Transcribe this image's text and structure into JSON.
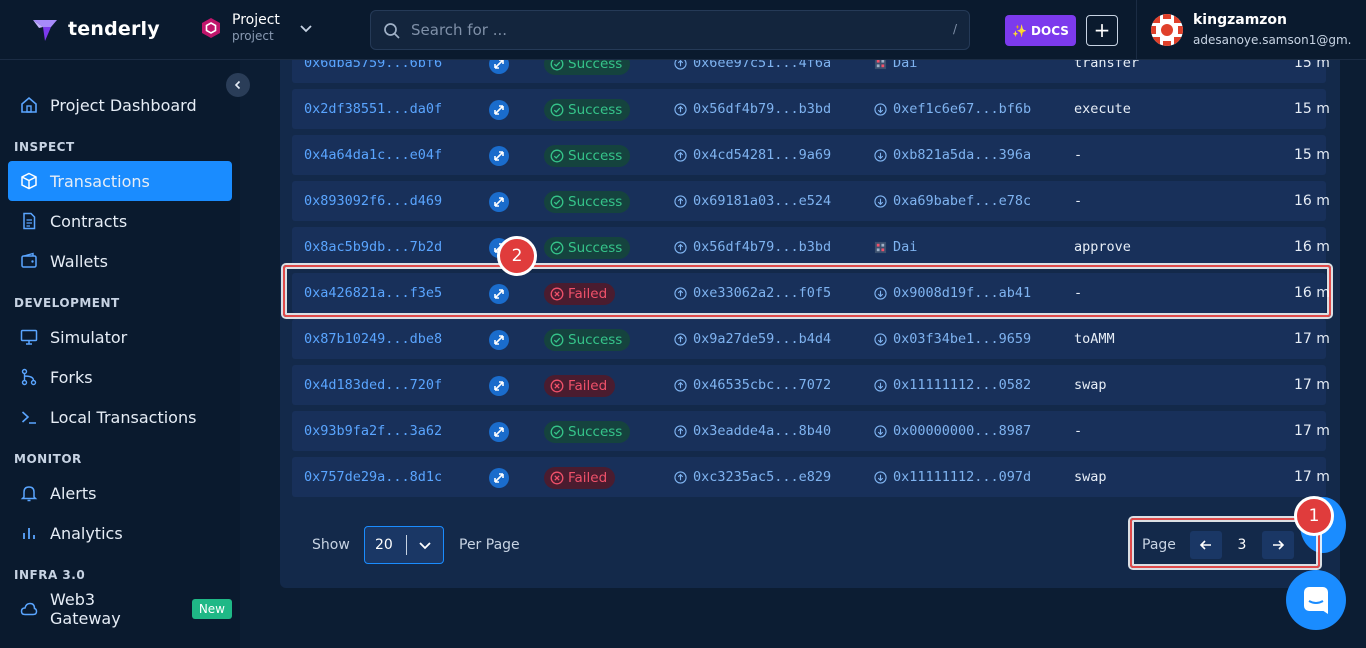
{
  "header": {
    "brand": "tenderly",
    "project_name": "Project",
    "project_sub": "project",
    "search_placeholder": "Search for ...",
    "search_shortcut": "/",
    "docs_label": "DOCS",
    "plus_label": "+",
    "user_name": "kingzamzon",
    "user_email": "adesanoye.samson1@gm..."
  },
  "sidebar": {
    "project_dashboard": "Project Dashboard",
    "sections": {
      "inspect": "INSPECT",
      "development": "DEVELOPMENT",
      "monitor": "MONITOR",
      "infra": "INFRA 3.0"
    },
    "items": {
      "transactions": "Transactions",
      "contracts": "Contracts",
      "wallets": "Wallets",
      "simulator": "Simulator",
      "forks": "Forks",
      "local_transactions": "Local Transactions",
      "alerts": "Alerts",
      "analytics": "Analytics",
      "web3_gateway": "Web3 Gateway"
    },
    "new_badge": "New"
  },
  "table": {
    "rows": [
      {
        "hash": "0x6dba5759...6bf6",
        "status": "Success",
        "from": "0x6ee97c51...4f6a",
        "to": "Dai",
        "to_is_token": true,
        "fn": "transfer",
        "time": "15 m"
      },
      {
        "hash": "0x2df38551...da0f",
        "status": "Success",
        "from": "0x56df4b79...b3bd",
        "to": "0xef1c6e67...bf6b",
        "to_is_token": false,
        "fn": "execute",
        "time": "15 m"
      },
      {
        "hash": "0x4a64da1c...e04f",
        "status": "Success",
        "from": "0x4cd54281...9a69",
        "to": "0xb821a5da...396a",
        "to_is_token": false,
        "fn": "-",
        "time": "15 m"
      },
      {
        "hash": "0x893092f6...d469",
        "status": "Success",
        "from": "0x69181a03...e524",
        "to": "0xa69babef...e78c",
        "to_is_token": false,
        "fn": "-",
        "time": "16 m"
      },
      {
        "hash": "0x8ac5b9db...7b2d",
        "status": "Success",
        "from": "0x56df4b79...b3bd",
        "to": "Dai",
        "to_is_token": true,
        "fn": "approve",
        "time": "16 m"
      },
      {
        "hash": "0xa426821a...f3e5",
        "status": "Failed",
        "from": "0xe33062a2...f0f5",
        "to": "0x9008d19f...ab41",
        "to_is_token": false,
        "fn": "-",
        "time": "16 m"
      },
      {
        "hash": "0x87b10249...dbe8",
        "status": "Success",
        "from": "0x9a27de59...b4d4",
        "to": "0x03f34be1...9659",
        "to_is_token": false,
        "fn": "toAMM",
        "time": "17 m"
      },
      {
        "hash": "0x4d183ded...720f",
        "status": "Failed",
        "from": "0x46535cbc...7072",
        "to": "0x11111112...0582",
        "to_is_token": false,
        "fn": "swap",
        "time": "17 m"
      },
      {
        "hash": "0x93b9fa2f...3a62",
        "status": "Success",
        "from": "0x3eadde4a...8b40",
        "to": "0x00000000...8987",
        "to_is_token": false,
        "fn": "-",
        "time": "17 m"
      },
      {
        "hash": "0x757de29a...8d1c",
        "status": "Failed",
        "from": "0xc3235ac5...e829",
        "to": "0x11111112...097d",
        "to_is_token": false,
        "fn": "swap",
        "time": "17 m"
      }
    ]
  },
  "pagination": {
    "show_label": "Show",
    "per_page_value": "20",
    "per_page_label": "Per Page",
    "page_label": "Page",
    "current_page": "3"
  },
  "annotations": {
    "marker_1": "1",
    "marker_2": "2"
  },
  "colors": {
    "accent": "#1a8cff",
    "success": "#35c48a",
    "failed": "#f0516a",
    "docs": "#7c3aed"
  }
}
